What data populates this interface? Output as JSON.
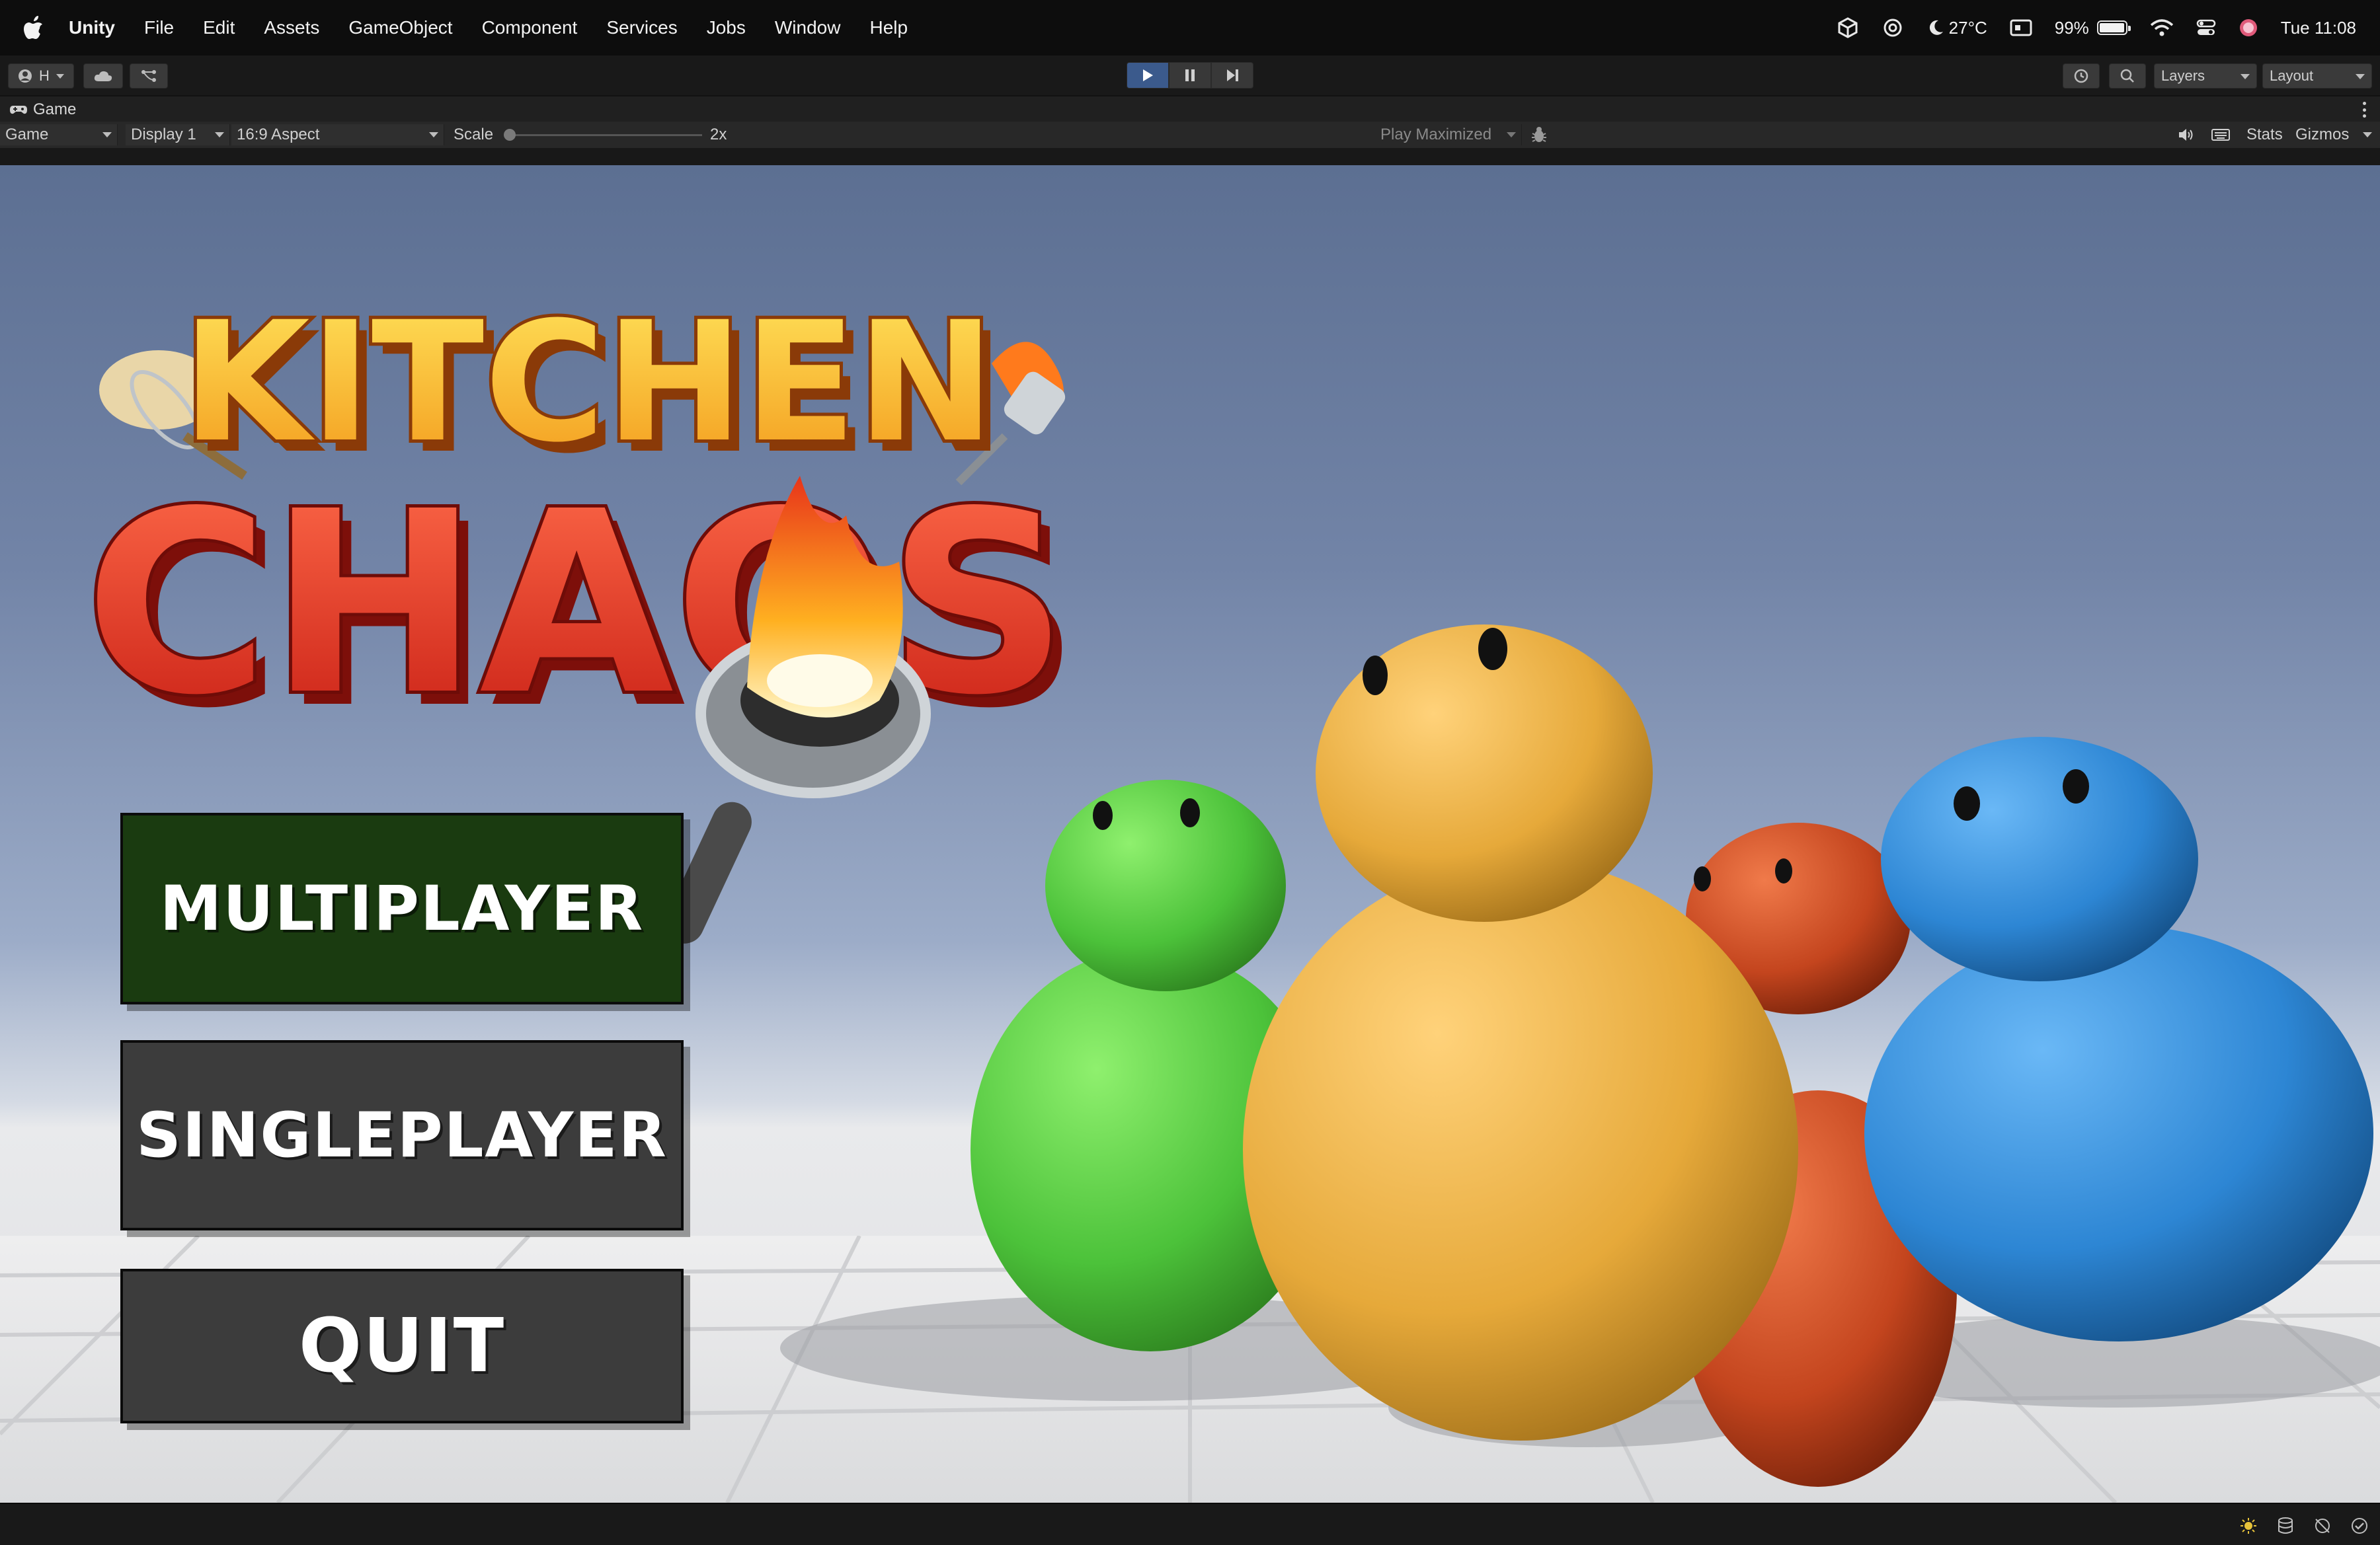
{
  "menubar": {
    "app_name": "Unity",
    "items": [
      "File",
      "Edit",
      "Assets",
      "GameObject",
      "Component",
      "Services",
      "Jobs",
      "Window",
      "Help"
    ],
    "weather": "27°C",
    "battery": "99%",
    "battery_level": 0.99,
    "clock": "Tue 11:08"
  },
  "toolbar": {
    "account_label": "H",
    "layers_label": "Layers",
    "layout_label": "Layout"
  },
  "game_view": {
    "tab_label": "Game",
    "view_dropdown": "Game",
    "display_dropdown": "Display 1",
    "aspect_dropdown": "16:9 Aspect",
    "scale_label": "Scale",
    "scale_value": "2x",
    "play_mode": "Play Maximized",
    "stats_label": "Stats",
    "gizmos_label": "Gizmos"
  },
  "game": {
    "logo": {
      "line1": "KITCHEN",
      "line2": "CHAOS"
    },
    "buttons": {
      "multiplayer": "MULTIPLAYER",
      "singleplayer": "SINGLEPLAYER",
      "quit": "QUIT"
    },
    "colors": {
      "multiplayer_bg": "#1a3b10",
      "button_bg": "#3c3c3c",
      "green_char": "#4cc23a",
      "yellow_char": "#e6a93a",
      "red_char": "#c4451e",
      "blue_char": "#2d86d4"
    }
  }
}
